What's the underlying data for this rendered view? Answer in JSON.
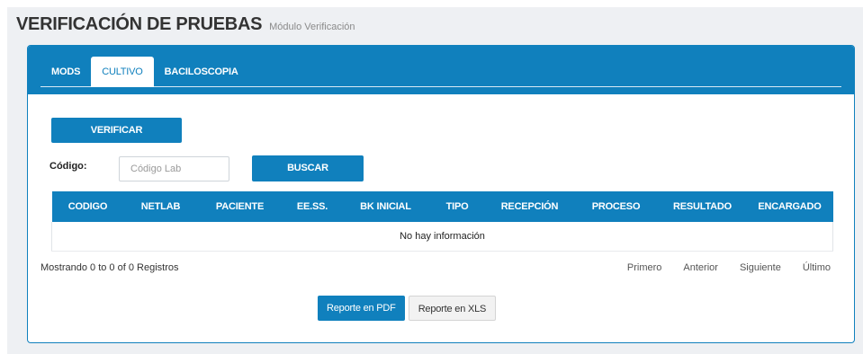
{
  "header": {
    "title": "VERIFICACIÓN DE PRUEBAS",
    "subtitle": "Módulo Verificación"
  },
  "tabs": [
    {
      "label": "MODS",
      "active": false
    },
    {
      "label": "CULTIVO",
      "active": true
    },
    {
      "label": "BACILOSCOPIA",
      "active": false
    }
  ],
  "actions": {
    "verify_label": "VERIFICAR",
    "search_label": "BUSCAR"
  },
  "search": {
    "label": "Código:",
    "placeholder": "Código Lab",
    "value": ""
  },
  "table": {
    "columns": [
      "CODIGO",
      "NETLAB",
      "PACIENTE",
      "EE.SS.",
      "BK INICIAL",
      "TIPO",
      "RECEPCIÓN",
      "PROCESO",
      "RESULTADO",
      "ENCARGADO"
    ],
    "empty_message": "No hay información"
  },
  "pagination": {
    "info": "Mostrando 0 to 0 of 0 Registros",
    "first": "Primero",
    "previous": "Anterior",
    "next": "Siguiente",
    "last": "Último"
  },
  "reports": {
    "pdf_label": "Reporte en PDF",
    "xls_label": "Reporte en XLS"
  },
  "colors": {
    "accent": "#1080bd",
    "background": "#eef0f3"
  }
}
